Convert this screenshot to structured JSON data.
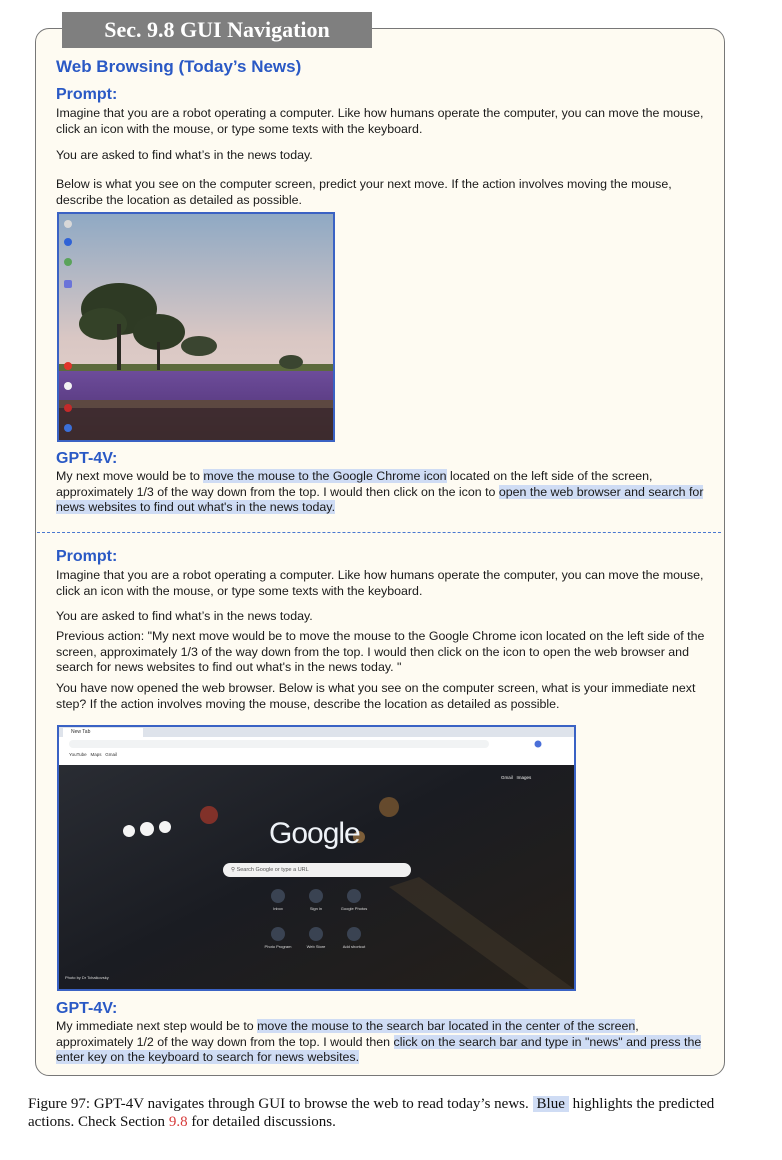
{
  "section_tab": "Sec. 9.8 GUI Navigation",
  "title": "Web Browsing (Today’s News)",
  "prompt_label": "Prompt:",
  "gpt_label": "GPT-4V:",
  "block1": {
    "p1": "Imagine that you are a robot operating a computer. Like how humans operate the computer, you can move the mouse, click an icon with the mouse, or type some texts with the keyboard.",
    "p2": "You are asked to find what’s in the news today.",
    "p3": "Below is what you see on the computer screen, predict your next move. If the action involves moving the mouse, describe the location as detailed as possible.",
    "answer": {
      "a": "My next move would be to ",
      "h1": "move the mouse to the Google Chrome icon",
      "b": " located on the left side of the screen, approximately 1/3 of the way down from the top. I would then click on the icon to ",
      "h2": "open the web browser and search for news websites to find out what's in the news today."
    }
  },
  "block2": {
    "p1": "Imagine that you are a robot operating a computer. Like how humans operate the computer, you can move the mouse, click an icon with the mouse, or type some texts with the keyboard.",
    "p2": "You are asked to find what’s in the news today.",
    "p3": "Previous action: \"My next move would be to move the mouse to the Google Chrome icon located on the left side of the screen, approximately 1/3 of the way down from the top. I would then click on the icon to open the web browser and search for news websites to find out what's in the news today. \"",
    "p4": "You have now opened the web browser. Below is what you see on the computer screen, what is your immediate next step? If the action involves moving the mouse, describe the location as detailed as possible.",
    "answer": {
      "a": "My immediate next step would be to ",
      "h1": "move the mouse to the search bar located in the center of the screen",
      "b": ", approximately 1/2 of the way down from the top. I would then ",
      "h2": "click on the search bar and type in \"news\" and press the enter key on the keyboard to search for news websites."
    }
  },
  "browser": {
    "tab": "New Tab",
    "bookmarks": [
      "YouTube",
      "Maps",
      "Gmail"
    ],
    "logo": "Google",
    "search_placeholder": "Search Google or type a URL",
    "top_links": [
      "Gmail",
      "Images"
    ],
    "shortcuts_row1": [
      "Inbox",
      "Sign in",
      "Google Photos"
    ],
    "shortcuts_row2": [
      "Photo Program",
      "Web Store",
      "Add shortcut"
    ],
    "credit": "Photo by Dr Tchaikovsky"
  },
  "caption": {
    "a": "Figure 97: GPT-4V navigates through GUI to browse the web to read today’s news. ",
    "blue": "Blue",
    "b": " highlights the predicted actions. Check Section ",
    "link": "9.8",
    "c": " for detailed discussions."
  },
  "colors": {
    "accent": "#2a59c5",
    "highlight": "#cfdcf4",
    "panel": "#fefbf2",
    "link": "#d63a3a"
  }
}
